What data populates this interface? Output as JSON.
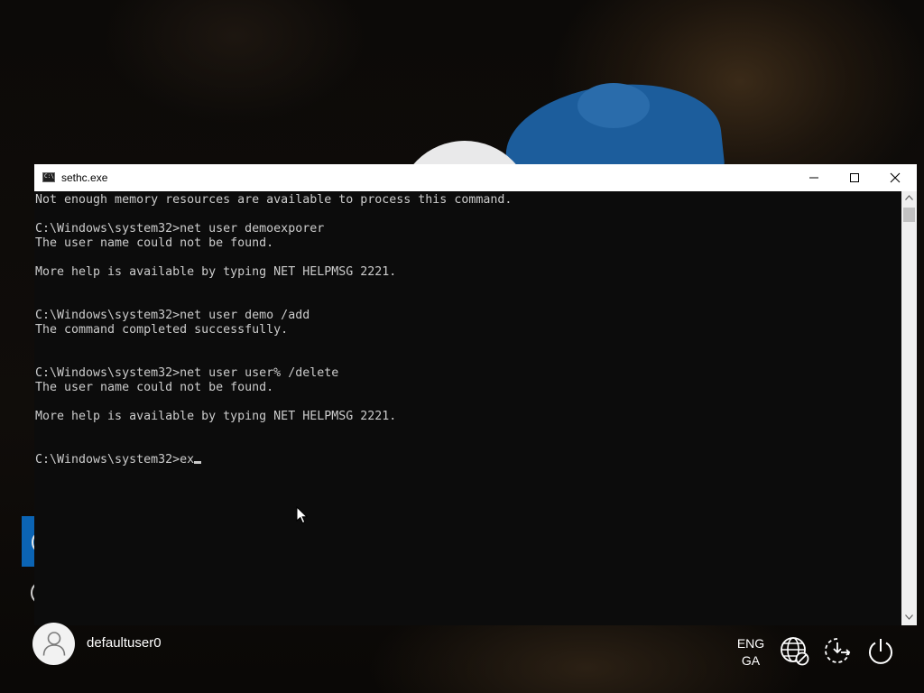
{
  "window": {
    "title": "sethc.exe",
    "icon": "console-app-icon",
    "controls": [
      "minimize-icon",
      "maximize-icon",
      "close-icon"
    ]
  },
  "console": {
    "lines": [
      "Not enough memory resources are available to process this command.",
      "",
      "C:\\Windows\\system32>net user demoexporer",
      "The user name could not be found.",
      "",
      "More help is available by typing NET HELPMSG 2221.",
      "",
      "",
      "C:\\Windows\\system32>net user demo /add",
      "The command completed successfully.",
      "",
      "",
      "C:\\Windows\\system32>net user user% /delete",
      "The user name could not be found.",
      "",
      "More help is available by typing NET HELPMSG 2221.",
      "",
      "",
      "C:\\Windows\\system32>ex"
    ],
    "foreground": "#cccccc",
    "background": "#0c0c0c"
  },
  "lockscreen": {
    "user_name": "defaultuser0",
    "language_line1": "ENG",
    "language_line2": "GA",
    "icons": [
      "user-avatar-icon",
      "network-icon",
      "ease-of-access-icon",
      "power-icon"
    ],
    "accent": "#0b64b4"
  }
}
